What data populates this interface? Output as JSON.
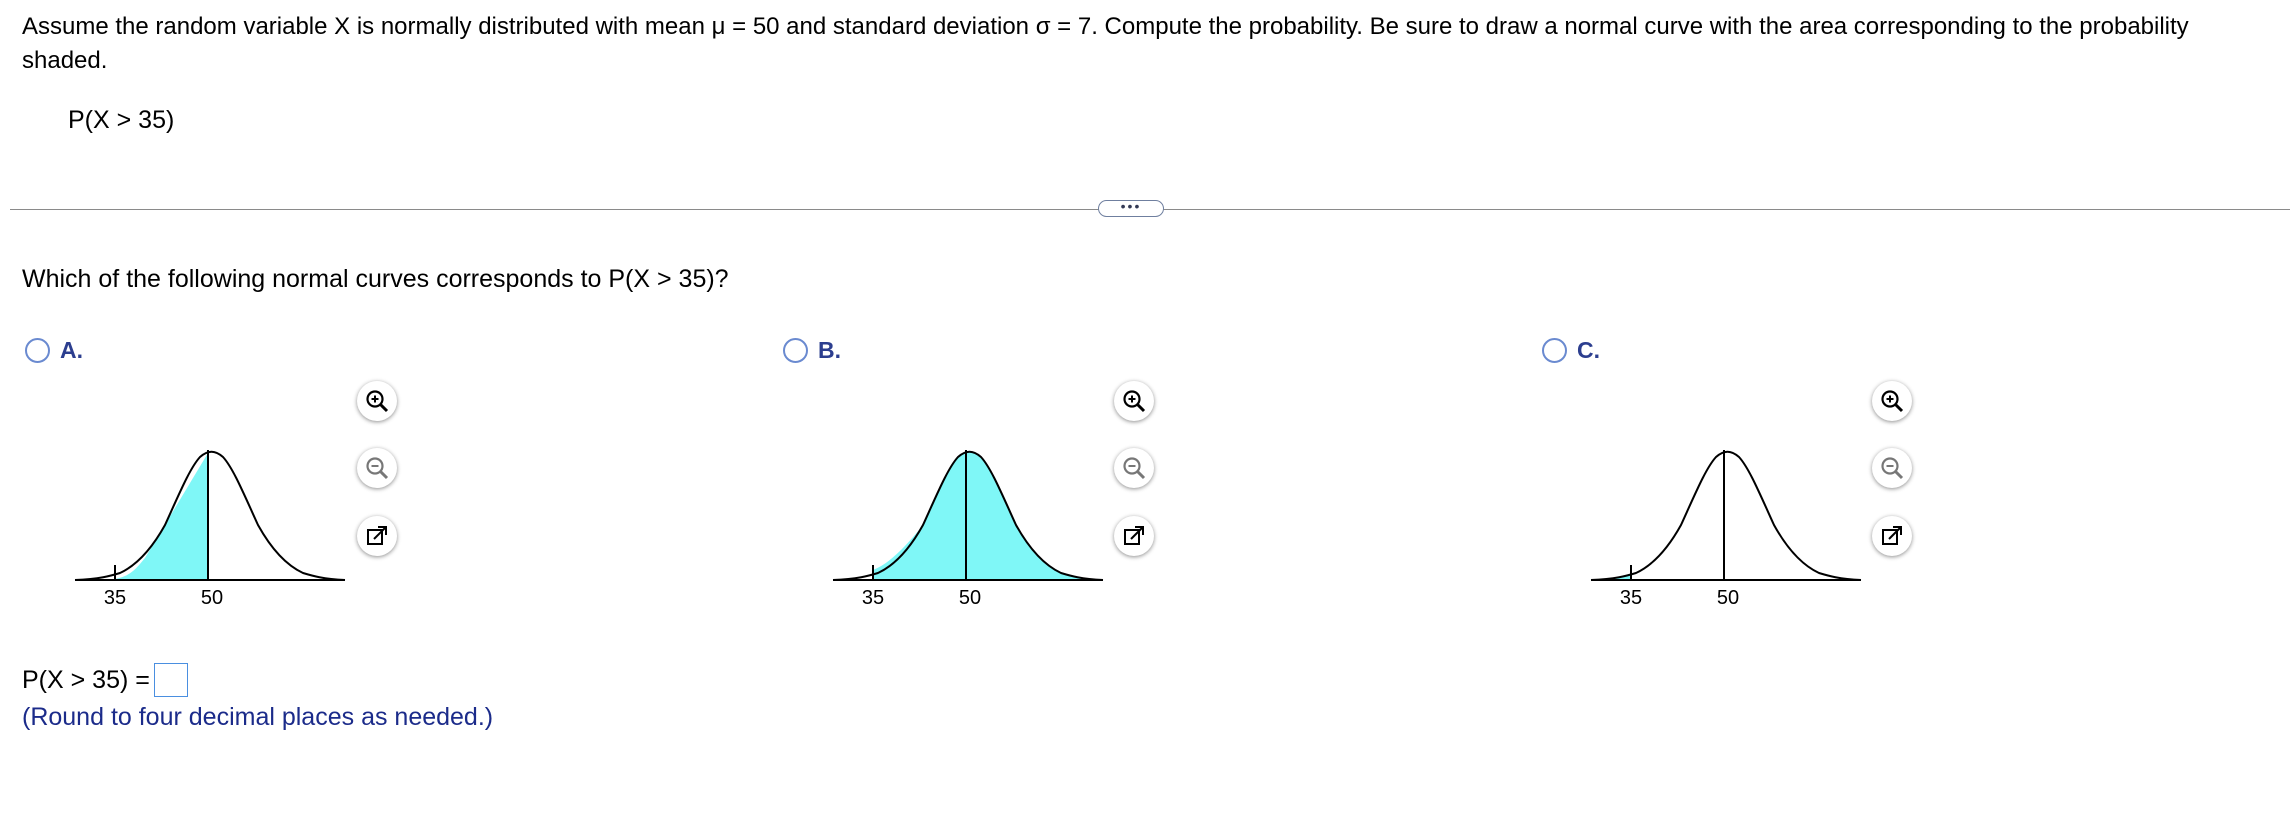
{
  "question": {
    "text": "Assume the random variable X is normally distributed with mean μ = 50 and standard deviation σ = 7. Compute the probability. Be sure to draw a normal curve with the area corresponding to the probability shaded.",
    "probability": "P(X > 35)"
  },
  "more_button": {
    "label": "•••"
  },
  "subquestion": {
    "text": "Which of the following normal curves corresponds to P(X > 35)?"
  },
  "options": [
    {
      "label": "A.",
      "shading": "between",
      "ticks": [
        "35",
        "50"
      ],
      "tools": [
        "zoom-in-icon",
        "zoom-out-icon",
        "open-external-icon"
      ]
    },
    {
      "label": "B.",
      "shading": "right-of-35",
      "ticks": [
        "35",
        "50"
      ],
      "tools": [
        "zoom-in-icon",
        "zoom-out-icon",
        "open-external-icon"
      ]
    },
    {
      "label": "C.",
      "shading": "left-of-35",
      "ticks": [
        "35",
        "50"
      ],
      "tools": [
        "zoom-in-icon",
        "zoom-out-icon",
        "open-external-icon"
      ]
    }
  ],
  "answer": {
    "prefix": "P(X > 35) =",
    "value": "",
    "note": "(Round to four decimal places as needed.)"
  },
  "colors": {
    "shade": "#7ff7f7",
    "accent": "#2c3e8f",
    "radio_border": "#6a8ad0",
    "input_border": "#4a8fe0"
  }
}
